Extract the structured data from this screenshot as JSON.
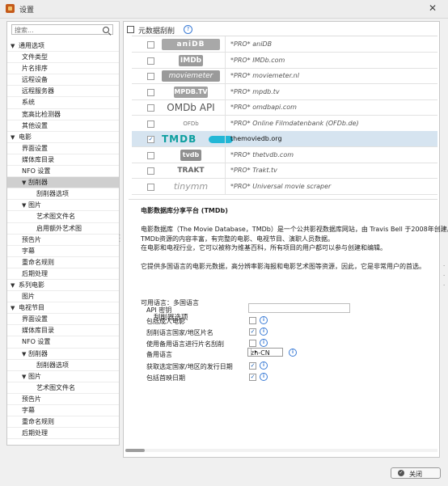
{
  "window": {
    "title": "设置",
    "close_glyph": "✕"
  },
  "search": {
    "placeholder": "搜索..."
  },
  "tree": [
    {
      "label": "通用选项",
      "level": 0,
      "caret": "▼"
    },
    {
      "label": "文件类型",
      "level": 2
    },
    {
      "label": "片名排序",
      "level": 2
    },
    {
      "label": "远程设备",
      "level": 2
    },
    {
      "label": "远程服务器",
      "level": 2
    },
    {
      "label": "系统",
      "level": 2
    },
    {
      "label": "宽高比检测器",
      "level": 2
    },
    {
      "label": "其他设置",
      "level": 2
    },
    {
      "label": "电影",
      "level": 0,
      "caret": "▼"
    },
    {
      "label": "界面设置",
      "level": 2
    },
    {
      "label": "媒体库目录",
      "level": 2
    },
    {
      "label": "NFO 设置",
      "level": 2
    },
    {
      "label": "刮削器",
      "level": 1,
      "caret": "▼",
      "selected": true
    },
    {
      "label": "刮削器选项",
      "level": 3
    },
    {
      "label": "图片",
      "level": 1,
      "caret": "▼"
    },
    {
      "label": "艺术图文件名",
      "level": 3
    },
    {
      "label": "启用额外艺术图",
      "level": 3
    },
    {
      "label": "预告片",
      "level": 2
    },
    {
      "label": "字幕",
      "level": 2
    },
    {
      "label": "重命名规则",
      "level": 2
    },
    {
      "label": "后期处理",
      "level": 2
    },
    {
      "label": "系列电影",
      "level": 0,
      "caret": "▼"
    },
    {
      "label": "图片",
      "level": 2
    },
    {
      "label": "电视节目",
      "level": 0,
      "caret": "▼"
    },
    {
      "label": "界面设置",
      "level": 2
    },
    {
      "label": "媒体库目录",
      "level": 2
    },
    {
      "label": "NFO 设置",
      "level": 2
    },
    {
      "label": "刮削器",
      "level": 1,
      "caret": "▼"
    },
    {
      "label": "刮削器选项",
      "level": 3
    },
    {
      "label": "图片",
      "level": 1,
      "caret": "▼"
    },
    {
      "label": "艺术图文件名",
      "level": 3
    },
    {
      "label": "预告片",
      "level": 2
    },
    {
      "label": "字幕",
      "level": 2
    },
    {
      "label": "重命名规则",
      "level": 2
    },
    {
      "label": "后期处理",
      "level": 2
    }
  ],
  "metadata": {
    "header": "元数据刮削",
    "help_glyph": "?",
    "scrapers": [
      {
        "logo": "aniDB",
        "logo_class": "anidb",
        "name": "*PRO* aniDB",
        "checked": false
      },
      {
        "logo": "IMDb",
        "logo_class": "imdb",
        "name": "*PRO* IMDb.com",
        "checked": false
      },
      {
        "logo": "moviemeter",
        "logo_class": "mm",
        "name": "*PRO* moviemeter.nl",
        "checked": false
      },
      {
        "logo": "MPDB.TV",
        "logo_class": "mpdb",
        "name": "*PRO* mpdb.tv",
        "checked": false
      },
      {
        "logo": "OMDb API",
        "logo_class": "omdb",
        "name": "*PRO* omdbapi.com",
        "checked": false
      },
      {
        "logo": "OFDb",
        "logo_class": "ofdb",
        "name": "*PRO* Online Filmdatenbank (OFDb.de)",
        "checked": false
      },
      {
        "logo": "TMDB",
        "logo_class": "tmdb",
        "name": "themoviedb.org",
        "checked": true,
        "selected": true
      },
      {
        "logo": "tvdb",
        "logo_class": "tvdb",
        "name": "*PRO* thetvdb.com",
        "checked": false
      },
      {
        "logo": "TRAKT",
        "logo_class": "trakt",
        "name": "*PRO* Trakt.tv",
        "checked": false
      },
      {
        "logo": "tinymm",
        "logo_class": "tinymm",
        "name": "*PRO* Universal movie scraper",
        "checked": false
      }
    ],
    "check_glyph": "✓"
  },
  "description": {
    "title": "电影数据库分享平台 (TMDb)",
    "lines": [
      "电影数据库（The Movie Database，TMDb）是一个公共影视数据库网站，由 Travis Bell 于2008年创建。",
      "TMDb资源的内容丰富，有完整的电影、电视节目、演职人员数据。",
      "在电影和电视行业，它可以被称为维基百科，所有项目的用户都可以参与创建和编辑。",
      "它提供多国语言的电影元数据，高分辨率影海报和电影艺术图等资源，因此，它是非常用户的首选。"
    ],
    "languages": "可用语言：多国语言"
  },
  "options": {
    "title": "刮削器选项",
    "api_key_label": "API 密钥",
    "api_key_value": "",
    "info_glyph": "i",
    "items": [
      {
        "label": "包括成人电影",
        "checked": false
      },
      {
        "label": "刮削语言国家/地区片名",
        "checked": true
      },
      {
        "label": "使用备用语言进行片名刮削",
        "checked": false
      },
      {
        "label": "备用语言",
        "type": "select",
        "value": "zh-CN",
        "arrow": "▾"
      },
      {
        "label": "获取选定国家/地区的发行日期",
        "checked": true
      },
      {
        "label": "包括首映日期",
        "checked": true
      }
    ]
  },
  "footer": {
    "close_label": "关闭",
    "close_icon_glyph": "✓"
  },
  "edge_glyphs": [
    "·",
    "·",
    "·"
  ]
}
